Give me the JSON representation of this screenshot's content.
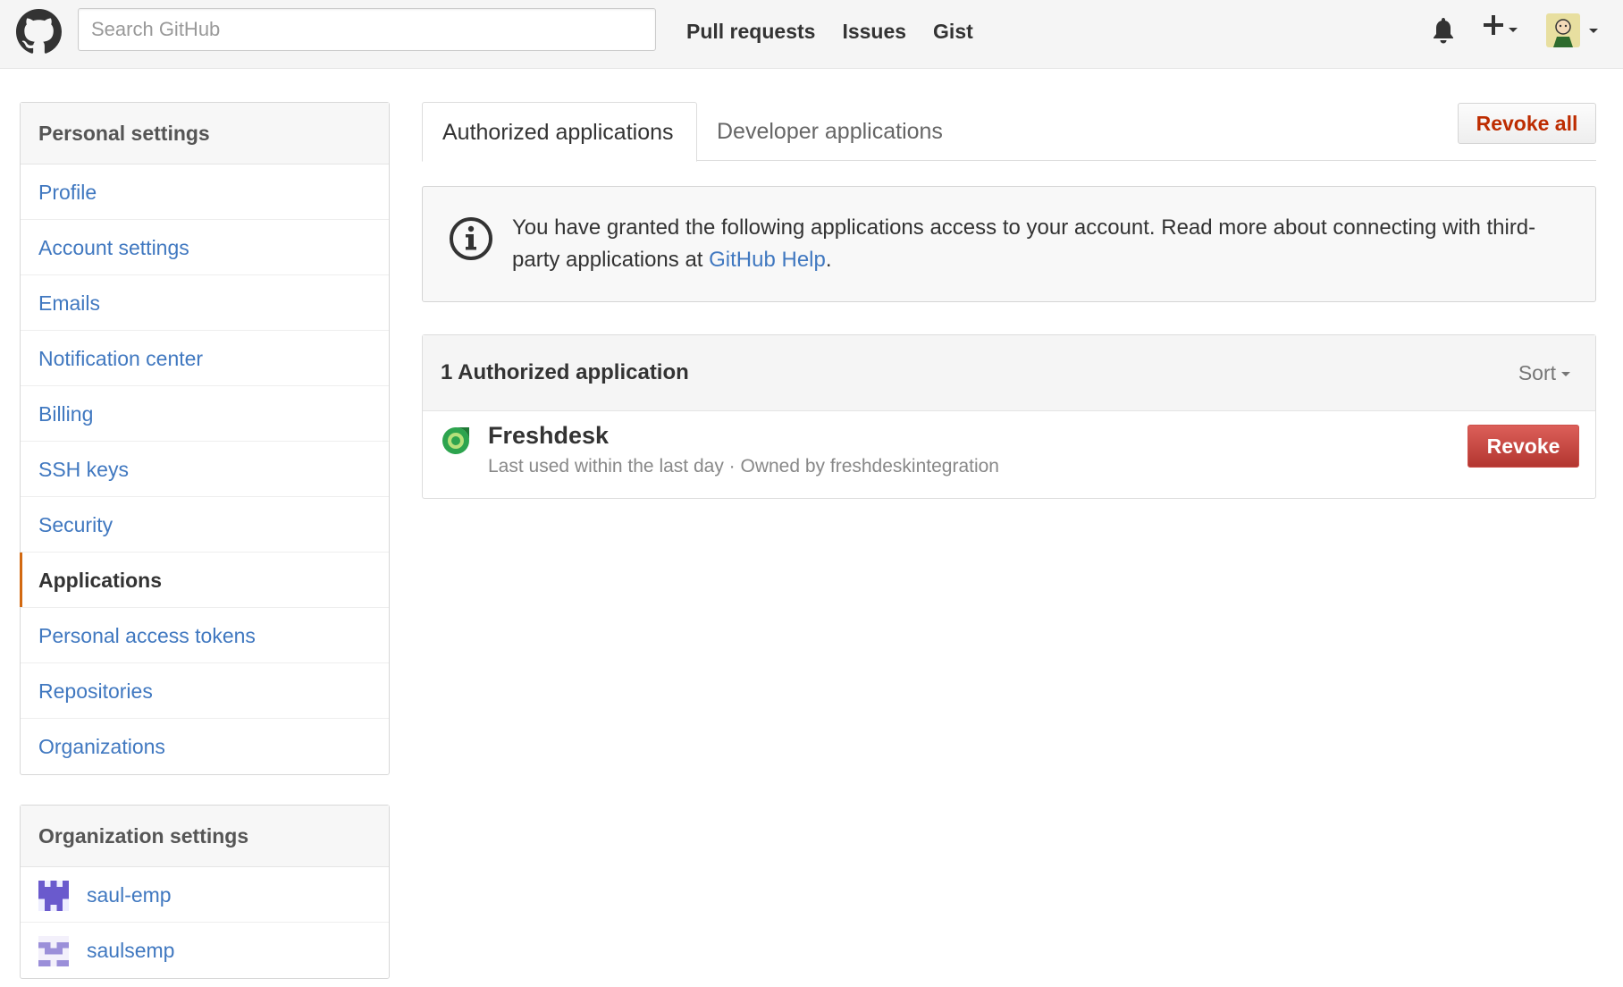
{
  "header": {
    "search_placeholder": "Search GitHub",
    "nav": [
      "Pull requests",
      "Issues",
      "Gist"
    ],
    "icons": {
      "logo": "github-octocat-icon",
      "notifications": "bell-icon",
      "create": "plus-icon",
      "avatar": "user-avatar"
    }
  },
  "sidebar": {
    "personal_heading": "Personal settings",
    "items": [
      {
        "label": "Profile"
      },
      {
        "label": "Account settings"
      },
      {
        "label": "Emails"
      },
      {
        "label": "Notification center"
      },
      {
        "label": "Billing"
      },
      {
        "label": "SSH keys"
      },
      {
        "label": "Security"
      },
      {
        "label": "Applications",
        "selected": true
      },
      {
        "label": "Personal access tokens"
      },
      {
        "label": "Repositories"
      },
      {
        "label": "Organizations"
      }
    ],
    "org_heading": "Organization settings",
    "orgs": [
      {
        "label": "saul-emp"
      },
      {
        "label": "saulsemp"
      }
    ]
  },
  "tabs": {
    "active": "Authorized applications",
    "other": "Developer applications",
    "revoke_all": "Revoke all"
  },
  "flash": {
    "text": "You have granted the following applications access to your account. Read more about connecting with third-party applications at ",
    "link": "GitHub Help",
    "suffix": "."
  },
  "apps": {
    "heading": "1 Authorized application",
    "sort": "Sort",
    "list": [
      {
        "name": "Freshdesk",
        "meta": "Last used within the last day · Owned by freshdeskintegration",
        "action": "Revoke"
      }
    ]
  },
  "colors": {
    "link": "#4078c0",
    "danger": "#bd2c00",
    "revoke_button": "#c9302c",
    "selected_accent": "#d26911"
  }
}
